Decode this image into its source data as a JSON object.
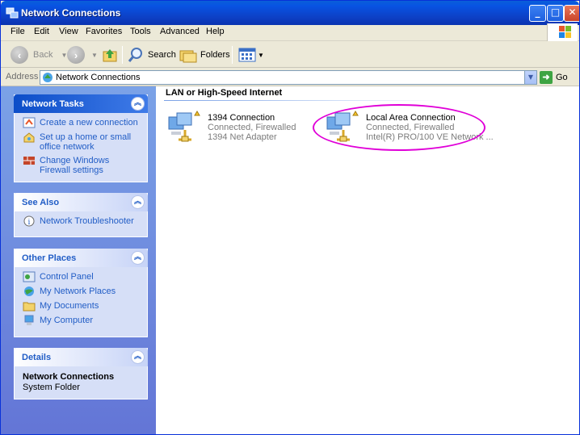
{
  "window": {
    "title": "Network Connections"
  },
  "menu": [
    "File",
    "Edit",
    "View",
    "Favorites",
    "Tools",
    "Advanced",
    "Help"
  ],
  "toolbar": {
    "back": "Back",
    "search": "Search",
    "folders": "Folders"
  },
  "address": {
    "label": "Address",
    "value": "Network Connections",
    "go": "Go"
  },
  "panels": {
    "network_tasks": {
      "title": "Network Tasks",
      "items": [
        "Create a new connection",
        "Set up a home or small office network",
        "Change Windows Firewall settings"
      ]
    },
    "see_also": {
      "title": "See Also",
      "items": [
        "Network Troubleshooter"
      ]
    },
    "other_places": {
      "title": "Other Places",
      "items": [
        "Control Panel",
        "My Network Places",
        "My Documents",
        "My Computer"
      ]
    },
    "details": {
      "title": "Details",
      "name": "Network Connections",
      "type": "System Folder"
    }
  },
  "content": {
    "group": "LAN or High-Speed Internet",
    "connections": [
      {
        "name": "1394 Connection",
        "status": "Connected, Firewalled",
        "device": "1394 Net Adapter"
      },
      {
        "name": "Local Area Connection",
        "status": "Connected, Firewalled",
        "device": "Intel(R) PRO/100 VE Network ..."
      }
    ]
  },
  "colors": {
    "titlebar": "#0a5fd8",
    "task_link": "#215dc6",
    "highlight": "#e000d8"
  }
}
